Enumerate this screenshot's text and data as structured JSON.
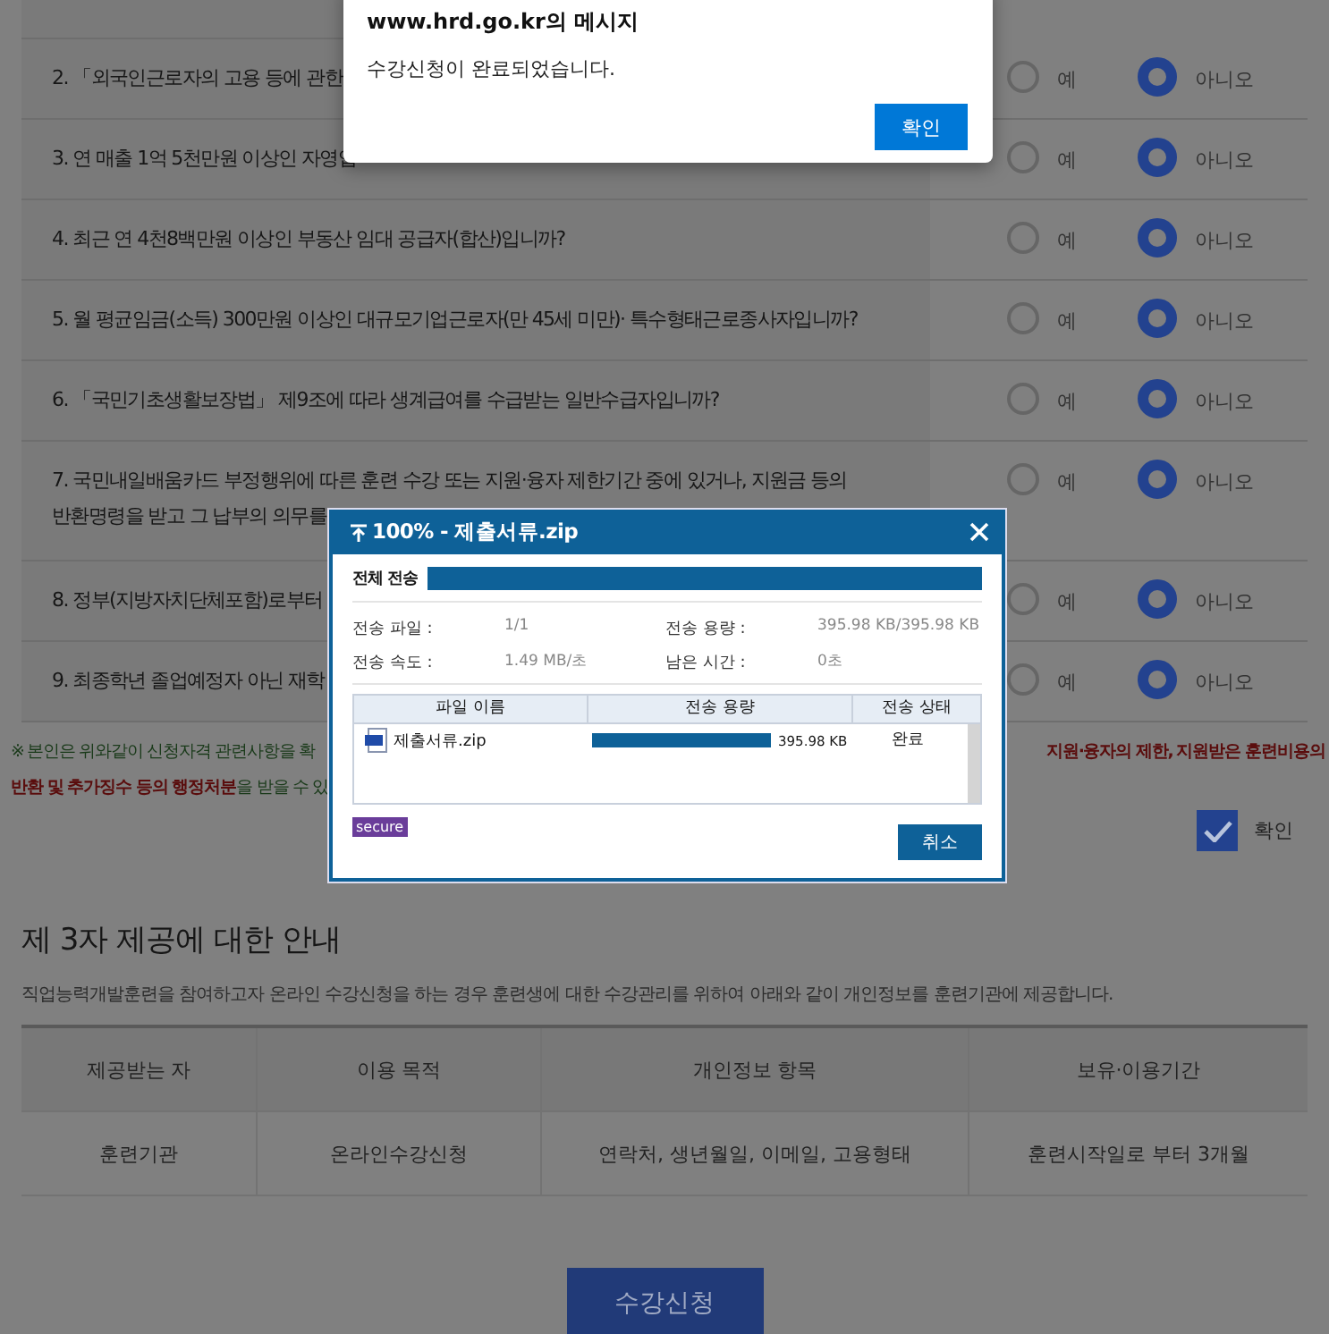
{
  "questions": [
    {
      "lines": [
        "2. 「외국인근로자의 고용 등에 관한"
      ],
      "options": [
        {
          "label": "예",
          "selected": false
        },
        {
          "label": "아니오",
          "selected": true
        }
      ]
    },
    {
      "lines": [
        "3. 연 매출 1억 5천만원 이상인 자영업"
      ],
      "options": [
        {
          "label": "예",
          "selected": false
        },
        {
          "label": "아니오",
          "selected": true
        }
      ]
    },
    {
      "lines": [
        "4. 최근 연 4천8백만원 이상인 부동산 임대 공급자(합산)입니까?"
      ],
      "options": [
        {
          "label": "예",
          "selected": false
        },
        {
          "label": "아니오",
          "selected": true
        }
      ]
    },
    {
      "lines": [
        "5. 월 평균임금(소득) 300만원 이상인 대규모기업근로자(만 45세 미만)· 특수형태근로종사자입니까?"
      ],
      "options": [
        {
          "label": "예",
          "selected": false
        },
        {
          "label": "아니오",
          "selected": true
        }
      ]
    },
    {
      "lines": [
        "6. 「국민기초생활보장법」 제9조에 따라 생계급여를 수급받는 일반수급자입니까?"
      ],
      "options": [
        {
          "label": "예",
          "selected": false
        },
        {
          "label": "아니오",
          "selected": true
        }
      ]
    },
    {
      "lines": [
        "7. 국민내일배움카드 부정행위에 따른 훈련 수강 또는 지원·융자 제한기간 중에 있거나, 지원금 등의",
        "반환명령을 받고 그 납부의 의무를"
      ],
      "options": [
        {
          "label": "예",
          "selected": false
        },
        {
          "label": "아니오",
          "selected": true
        }
      ]
    },
    {
      "lines": [
        "8. 정부(지방자치단체포함)로부터"
      ],
      "options": [
        {
          "label": "예",
          "selected": false
        },
        {
          "label": "아니오",
          "selected": true
        }
      ]
    },
    {
      "lines": [
        "9. 최종학년 졸업예정자 아닌 재학"
      ],
      "options": [
        {
          "label": "예",
          "selected": false
        },
        {
          "label": "아니오",
          "selected": true
        }
      ]
    }
  ],
  "notice": {
    "left": [
      "※ 본인은 위와같이 신청자격 관련사항을 확",
      "**반환 및 추가징수 등의 행정처분**을 받을 수 있"
    ],
    "right": "지원·융자의 제한, 지원받은 훈련비용의"
  },
  "confirm": {
    "label": "확인",
    "checked": true
  },
  "section": {
    "title": "제 3자 제공에 대한 안내",
    "description": "직업능력개발훈련을 참여하고자 온라인 수강신청을 하는 경우 훈련생에 대한 수강관리를 위하여 아래와 같이 개인정보를 훈련기관에 제공합니다."
  },
  "table": {
    "columns": [
      "제공받는 자",
      "이용 목적",
      "개인정보 항목",
      "보유·이용기간"
    ],
    "rows": [
      [
        "훈련기관",
        "온라인수강신청",
        "연락처, 생년월일, 이메일, 고용형태",
        "훈련시작일로 부터 3개월"
      ]
    ]
  },
  "submit_button": "수강신청",
  "alert": {
    "title": "www.hrd.go.kr의 메시지",
    "message": "수강신청이 완료되었습니다.",
    "button": "확인"
  },
  "upload": {
    "title": "100% - 제출서류.zip",
    "total": {
      "label": "전체 전송",
      "level": 1
    },
    "stats": [
      {
        "label": "전송 파일 :",
        "value": "1/1"
      },
      {
        "label": "전송 용량 :",
        "value": "395.98 KB/395.98 KB"
      },
      {
        "label": "전송 속도 :",
        "value": "1.49 MB/초"
      },
      {
        "label": "남은 시간 :",
        "value": "0초"
      }
    ],
    "columns": [
      "파일 이름",
      "전송 용량",
      "전송 상태"
    ],
    "files": [
      {
        "name": "제출서류.zip",
        "level": 1,
        "size": "395.98 KB",
        "status": "완료"
      }
    ],
    "badge": "secure",
    "cancel": "취소"
  }
}
